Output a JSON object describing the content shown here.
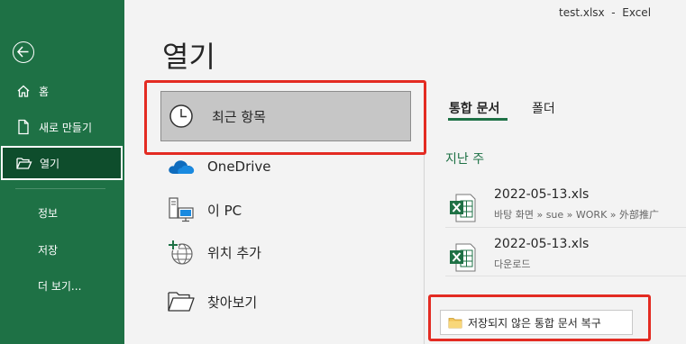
{
  "window": {
    "title": "test.xlsx  -  Excel"
  },
  "nav": {
    "back_icon": "back-arrow-icon",
    "items": [
      {
        "label": "홈",
        "icon": "home-icon"
      },
      {
        "label": "새로 만들기",
        "icon": "new-file-icon"
      },
      {
        "label": "열기",
        "icon": "folder-open-icon",
        "active": true
      },
      {
        "label": "정보"
      },
      {
        "label": "저장"
      },
      {
        "label": "더 보기..."
      }
    ]
  },
  "page": {
    "title": "열기"
  },
  "locations": [
    {
      "label": "최근 항목",
      "icon": "clock-icon",
      "selected": true
    },
    {
      "label": "OneDrive",
      "icon": "onedrive-cloud-icon"
    },
    {
      "label": "이 PC",
      "icon": "this-pc-icon"
    },
    {
      "label": "위치 추가",
      "icon": "globe-add-icon"
    },
    {
      "label": "찾아보기",
      "icon": "folder-browse-icon"
    }
  ],
  "tabs": [
    {
      "label": "통합 문서",
      "active": true
    },
    {
      "label": "폴더"
    }
  ],
  "recent": {
    "group_label": "지난 주",
    "files": [
      {
        "name": "2022-05-13.xls",
        "path": "바탕 화면 » sue » WORK » 外部推广",
        "icon": "excel-file-icon"
      },
      {
        "name": "2022-05-13.xls",
        "path": "다운로드",
        "icon": "excel-file-icon"
      }
    ]
  },
  "recover_button": {
    "label": "저장되지 않은 통합 문서 복구",
    "icon": "folder-icon"
  },
  "colors": {
    "accent": "#1e7145",
    "highlight_box": "#e32b22"
  }
}
